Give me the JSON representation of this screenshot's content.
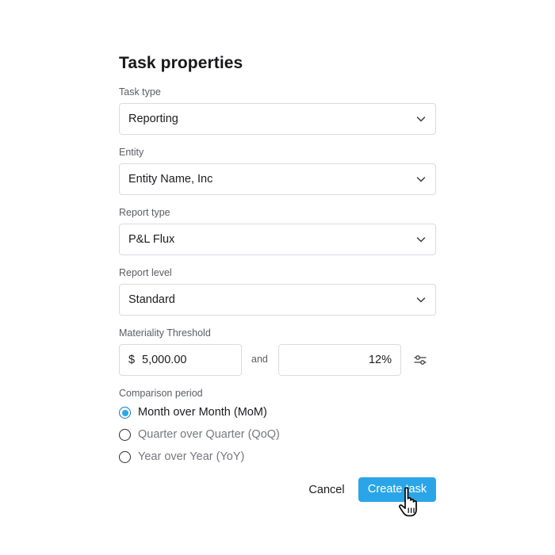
{
  "dialog": {
    "title": "Task properties"
  },
  "fields": {
    "task_type": {
      "label": "Task type",
      "value": "Reporting"
    },
    "entity": {
      "label": "Entity",
      "value": "Entity Name, Inc"
    },
    "report_type": {
      "label": "Report type",
      "value": "P&L Flux"
    },
    "report_level": {
      "label": "Report level",
      "value": "Standard"
    }
  },
  "materiality": {
    "label": "Materiality Threshold",
    "currency_symbol": "$",
    "amount": "5,000.00",
    "connector": "and",
    "percent": "12%"
  },
  "comparison": {
    "label": "Comparison period",
    "options": [
      {
        "label": "Month over Month (MoM)",
        "selected": true
      },
      {
        "label": "Quarter over Quarter (QoQ)",
        "selected": false
      },
      {
        "label": "Year over Year (YoY)",
        "selected": false
      }
    ]
  },
  "actions": {
    "cancel_label": "Cancel",
    "create_label": "Create task"
  },
  "colors": {
    "primary": "#2aa6e8",
    "radio_selected": "#29a7e8",
    "border": "#d9dbe0",
    "muted_text": "#76787e"
  },
  "icons": {
    "dropdown": "chevron-down-icon",
    "settings": "sliders-icon",
    "pointer": "hand-pointer-icon"
  }
}
